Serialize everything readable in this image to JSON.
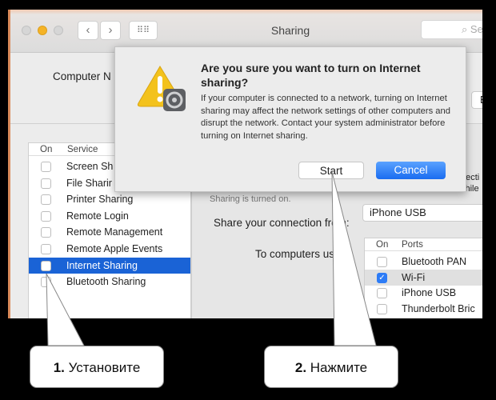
{
  "window": {
    "title": "Sharing",
    "search_placeholder": "Se",
    "computer_name_label": "Computer N",
    "edit_button_partial": "E"
  },
  "services": {
    "header_on": "On",
    "header_service": "Service",
    "items": [
      {
        "label": "Screen Sh",
        "checked": false
      },
      {
        "label": "File Sharir",
        "checked": false
      },
      {
        "label": "Printer Sharing",
        "checked": false
      },
      {
        "label": "Remote Login",
        "checked": false
      },
      {
        "label": "Remote Management",
        "checked": false
      },
      {
        "label": "Remote Apple Events",
        "checked": false
      },
      {
        "label": "Internet Sharing",
        "checked": false,
        "selected": true
      },
      {
        "label": "Bluetooth Sharing",
        "checked": false
      }
    ]
  },
  "detail": {
    "status_partial": "Sharing is turned on.",
    "side_text_1": "necti",
    "side_text_2": "vhile",
    "share_from_label": "Share your connection from:",
    "share_from_value": "iPhone USB",
    "to_computers_label": "To computers using:",
    "ports_header_on": "On",
    "ports_header_ports": "Ports",
    "ports": [
      {
        "label": "Bluetooth PAN",
        "checked": false
      },
      {
        "label": "Wi-Fi",
        "checked": true
      },
      {
        "label": "iPhone USB",
        "checked": false
      },
      {
        "label": "Thunderbolt Bric",
        "checked": false
      }
    ]
  },
  "dialog": {
    "title": "Are you sure you want to turn on Internet sharing?",
    "message": "If your computer is connected to a network, turning on Internet sharing may affect the network settings of other computers and disrupt the network. Contact your system administrator before turning on Internet sharing.",
    "start_label": "Start",
    "cancel_label": "Cancel",
    "icon": "warning-icon"
  },
  "callouts": [
    {
      "number": "1.",
      "text": "Установите"
    },
    {
      "number": "2.",
      "text": "Нажмите"
    }
  ],
  "colors": {
    "accent": "#1a63d6",
    "warning": "#f3c21c",
    "traffic_yellow": "#f5b326"
  }
}
